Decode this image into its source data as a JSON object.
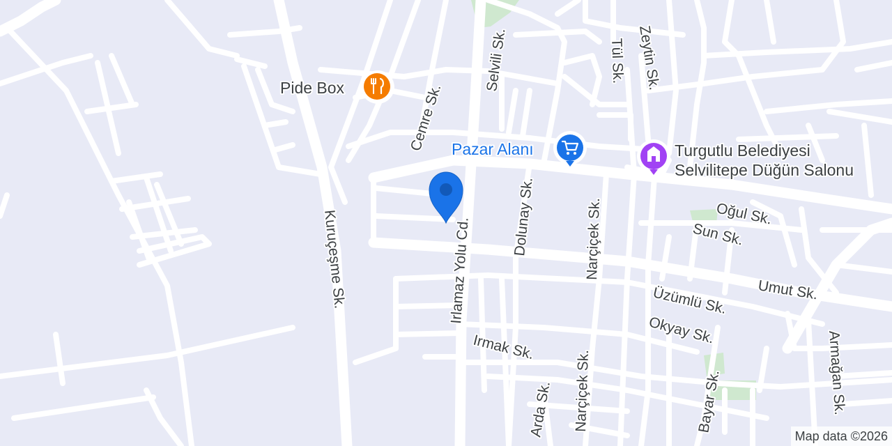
{
  "map": {
    "colors": {
      "background": "#e8eaf6",
      "road": "#ffffff",
      "park": "#cfe8cf",
      "label": "#3c4043",
      "pin": "#1a73e8",
      "food_poi": "#f57c00",
      "shop_poi": "#1a73e8",
      "venue_poi": "#a142f4"
    },
    "pois": {
      "pide_box": {
        "name": "Pide Box",
        "icon": "restaurant-icon"
      },
      "pazar_alani": {
        "name": "Pazar Alanı",
        "icon": "shopping-cart-icon"
      },
      "dugun_salonu": {
        "line1": "Turgutlu Belediyesi",
        "line2": "Selvilitepe Düğün Salonu",
        "icon": "civic-building-icon"
      }
    },
    "marker": {
      "icon": "location-pin-icon"
    },
    "streets": {
      "selvili": "Selvili Sk.",
      "tul": "Tül Sk.",
      "zeytin": "Zeytin Sk.",
      "cemre": "Cemre Sk.",
      "irlamaz": "Irlamaz Yolu Cd.",
      "dolunay": "Dolunay Sk.",
      "narcicek": "Narçiçek Sk.",
      "narcicek2": "Narçiçek Sk.",
      "kurucesme": "Kuruçeşme Sk.",
      "ogul": "Oğul Sk.",
      "sun": "Sun Sk.",
      "umut": "Umut Sk.",
      "uzumlu": "Üzümlü Sk.",
      "okyay": "Okyay Sk.",
      "irmak": "Irmak Sk.",
      "arda": "Arda Sk.",
      "bayar": "Bayar Sk.",
      "armagan": "Armağan Sk."
    },
    "attribution": "Map data ©2026"
  }
}
